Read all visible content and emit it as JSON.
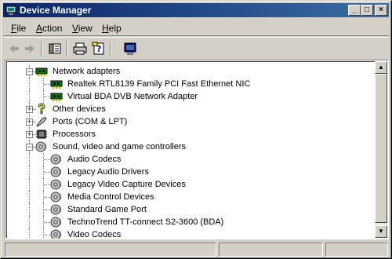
{
  "window": {
    "title": "Device Manager"
  },
  "titlebar_buttons": {
    "minimize": "_",
    "maximize": "□",
    "close": "×"
  },
  "menu": [
    {
      "label": "File",
      "u": "F",
      "rest": "ile"
    },
    {
      "label": "Action",
      "u": "A",
      "rest": "ction"
    },
    {
      "label": "View",
      "u": "V",
      "rest": "iew"
    },
    {
      "label": "Help",
      "u": "H",
      "rest": "elp"
    }
  ],
  "toolbar": {
    "buttons": [
      "back-icon",
      "forward-icon",
      "show-hide-console-tree-icon",
      "print-icon",
      "properties-icon",
      "scan-hardware-icon"
    ]
  },
  "tree": [
    {
      "label": "Network adapters",
      "icon": "network-adapter-icon",
      "level": 0,
      "expanded": true
    },
    {
      "label": "Realtek RTL8139 Family PCI Fast Ethernet NIC",
      "icon": "network-adapter-icon",
      "level": 1
    },
    {
      "label": "Virtual BDA DVB Network Adapter",
      "icon": "network-adapter-icon",
      "level": 1
    },
    {
      "label": "Other devices",
      "icon": "question-icon",
      "level": 0,
      "expanded": false
    },
    {
      "label": "Ports (COM & LPT)",
      "icon": "port-icon",
      "level": 0,
      "expanded": false
    },
    {
      "label": "Processors",
      "icon": "processor-icon",
      "level": 0,
      "expanded": false
    },
    {
      "label": "Sound, video and game controllers",
      "icon": "sound-icon",
      "level": 0,
      "expanded": true
    },
    {
      "label": "Audio Codecs",
      "icon": "sound-icon",
      "level": 1
    },
    {
      "label": "Legacy Audio Drivers",
      "icon": "sound-icon",
      "level": 1
    },
    {
      "label": "Legacy Video Capture Devices",
      "icon": "sound-icon",
      "level": 1
    },
    {
      "label": "Media Control Devices",
      "icon": "sound-icon",
      "level": 1
    },
    {
      "label": "Standard Game Port",
      "icon": "sound-icon",
      "level": 1
    },
    {
      "label": "TechnoTrend TT-connect S2-3600 (BDA)",
      "icon": "sound-icon",
      "level": 1
    },
    {
      "label": "Video Codecs",
      "icon": "sound-icon",
      "level": 1
    }
  ],
  "colors": {
    "title_start": "#0a246a",
    "title_end": "#3a6ea5",
    "chrome": "#d4d0c8"
  }
}
